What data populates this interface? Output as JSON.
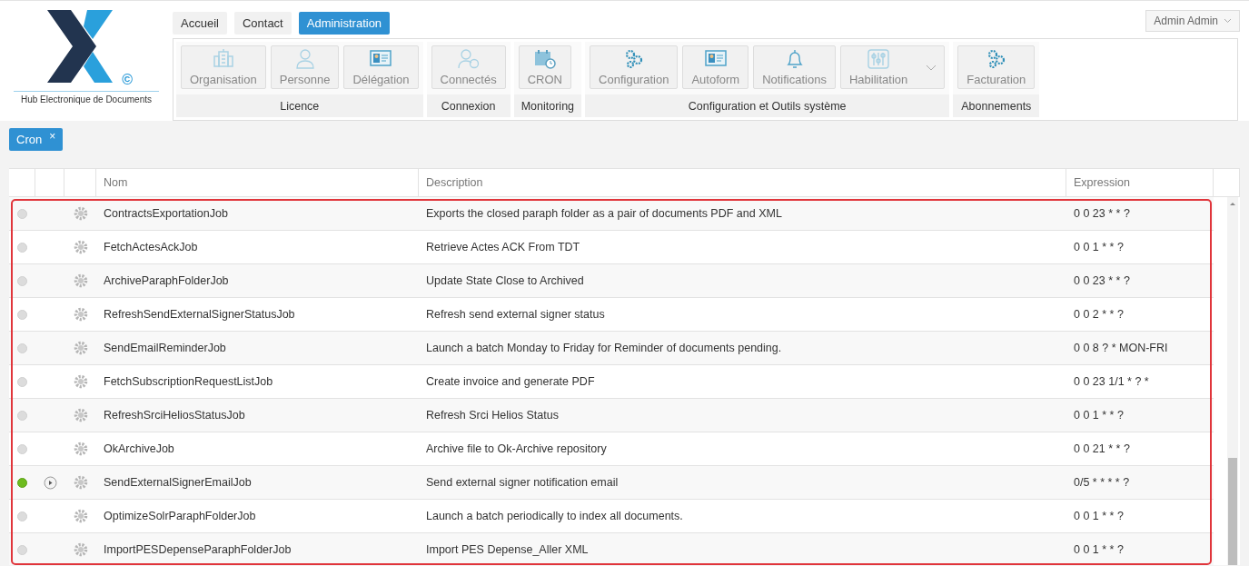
{
  "logo": {
    "caption": "Hub Electronique de Documents",
    "mark": "©"
  },
  "nav": [
    {
      "label": "Accueil",
      "selected": false
    },
    {
      "label": "Contact",
      "selected": false
    },
    {
      "label": "Administration",
      "selected": true
    }
  ],
  "user_menu": {
    "label": "Admin Admin"
  },
  "ribbon": [
    {
      "label": "Licence",
      "items": [
        {
          "label": "Organisation",
          "kind": "building"
        },
        {
          "label": "Personne",
          "kind": "person"
        },
        {
          "label": "Délégation",
          "kind": "card"
        }
      ]
    },
    {
      "label": "Connexion",
      "items": [
        {
          "label": "Connectés",
          "kind": "people"
        }
      ]
    },
    {
      "label": "Monitoring",
      "items": [
        {
          "label": "CRON",
          "kind": "calendar"
        }
      ]
    },
    {
      "label": "Configuration et Outils système",
      "items": [
        {
          "label": "Configuration",
          "kind": "gears"
        },
        {
          "label": "Autoform",
          "kind": "card"
        },
        {
          "label": "Notifications",
          "kind": "bell"
        },
        {
          "label": "Habilitation",
          "kind": "sliders",
          "dropdown": true
        }
      ]
    },
    {
      "label": "Abonnements",
      "items": [
        {
          "label": "Facturation",
          "kind": "gears"
        }
      ]
    }
  ],
  "open_tabs": [
    {
      "label": "Cron",
      "close": "×"
    }
  ],
  "table": {
    "columns": [
      "Nom",
      "Description",
      "Expression"
    ],
    "rows": [
      {
        "running": false,
        "name": "ContractsExportationJob",
        "description": "Exports the closed paraph folder as a pair of documents PDF and XML",
        "expression": "0 0 23 * * ?"
      },
      {
        "running": false,
        "name": "FetchActesAckJob",
        "description": "Retrieve Actes ACK From TDT",
        "expression": "0 0 1 * * ?"
      },
      {
        "running": false,
        "name": "ArchiveParaphFolderJob",
        "description": "Update State Close to Archived",
        "expression": "0 0 23 * * ?"
      },
      {
        "running": false,
        "name": "RefreshSendExternalSignerStatusJob",
        "description": "Refresh send external signer status",
        "expression": "0 0 2 * * ?"
      },
      {
        "running": false,
        "name": "SendEmailReminderJob",
        "description": "Launch a batch Monday to Friday for Reminder of documents pending.",
        "expression": "0 0 8 ? * MON-FRI"
      },
      {
        "running": false,
        "name": "FetchSubscriptionRequestListJob",
        "description": "Create invoice and generate PDF",
        "expression": "0 0 23 1/1 * ? *"
      },
      {
        "running": false,
        "name": "RefreshSrciHeliosStatusJob",
        "description": "Refresh Srci Helios Status",
        "expression": "0 0 1 * * ?"
      },
      {
        "running": false,
        "name": "OkArchiveJob",
        "description": "Archive file to Ok-Archive repository",
        "expression": "0 0 21 * * ?"
      },
      {
        "running": true,
        "name": "SendExternalSignerEmailJob",
        "description": "Send external signer notification email",
        "expression": "0/5 * * * * ?"
      },
      {
        "running": false,
        "name": "OptimizeSolrParaphFolderJob",
        "description": "Launch a batch periodically to index all documents.",
        "expression": "0 0 1 * * ?"
      },
      {
        "running": false,
        "name": "ImportPESDepenseParaphFolderJob",
        "description": "Import PES Depense_Aller XML",
        "expression": "0 0 1 * * ?"
      }
    ]
  }
}
